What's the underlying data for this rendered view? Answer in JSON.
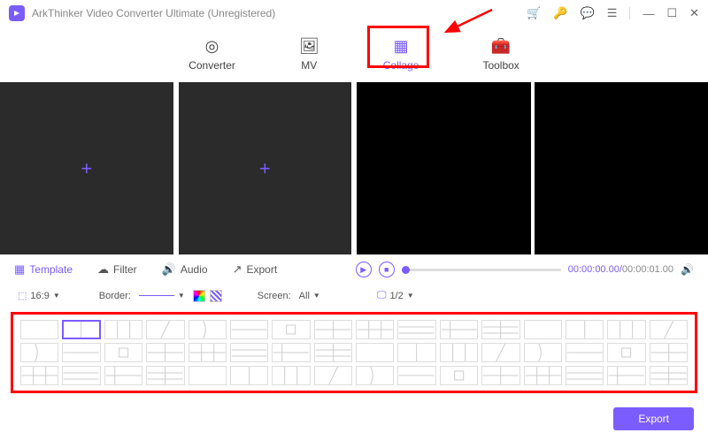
{
  "title": "ArkThinker Video Converter Ultimate (Unregistered)",
  "nav": {
    "converter": "Converter",
    "mv": "MV",
    "collage": "Collage",
    "toolbox": "Toolbox"
  },
  "tabs": {
    "template": "Template",
    "filter": "Filter",
    "audio": "Audio",
    "export": "Export"
  },
  "player": {
    "current": "00:00:00.00",
    "total": "00:00:01.00"
  },
  "options": {
    "ratio": "16:9",
    "border_label": "Border:",
    "screen_label": "Screen:",
    "screen_value": "All",
    "page": "1/2"
  },
  "footer": {
    "export": "Export"
  }
}
